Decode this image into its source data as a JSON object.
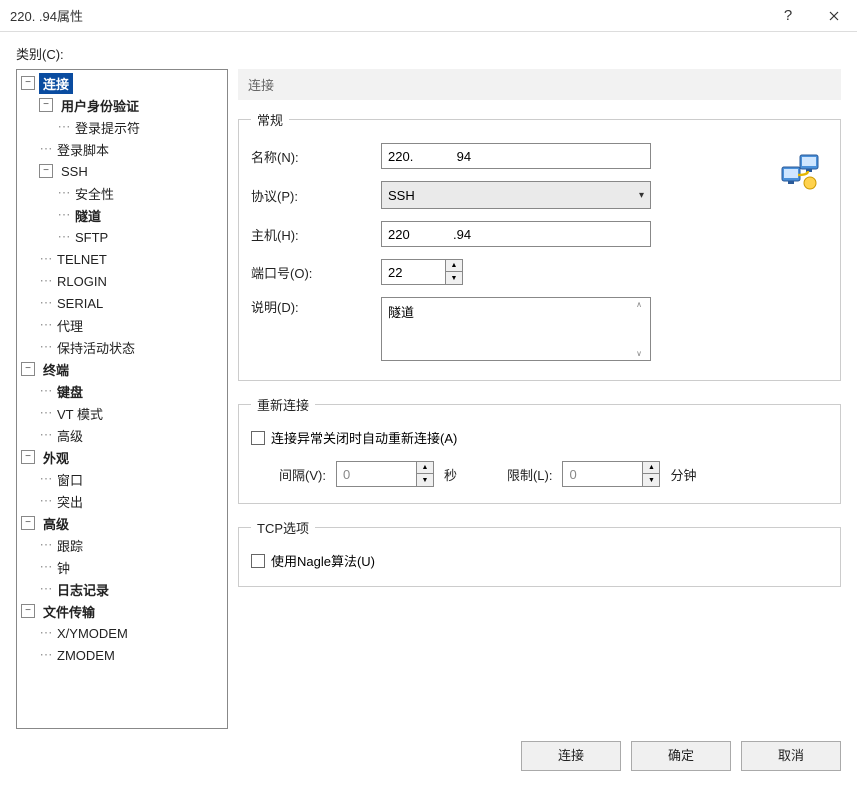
{
  "window": {
    "title": "220.          .94属性",
    "help": "?",
    "close": "×"
  },
  "category_label": "类别(C):",
  "tree": {
    "connection": "连接",
    "user_auth": "用户身份验证",
    "login_prompt": "登录提示符",
    "login_script": "登录脚本",
    "ssh": "SSH",
    "security": "安全性",
    "tunnel": "隧道",
    "sftp": "SFTP",
    "telnet": "TELNET",
    "rlogin": "RLOGIN",
    "serial": "SERIAL",
    "proxy": "代理",
    "keepalive": "保持活动状态",
    "terminal": "终端",
    "keyboard": "键盘",
    "vtmode": "VT 模式",
    "advanced_term": "高级",
    "appearance": "外观",
    "window": "窗口",
    "popup": "突出",
    "advanced": "高级",
    "trace": "跟踪",
    "clock": "钟",
    "logging": "日志记录",
    "filetransfer": "文件传输",
    "xymodem": "X/YMODEM",
    "zmodem": "ZMODEM"
  },
  "section_path": "连接",
  "general": {
    "legend": "常规",
    "name_label": "名称(N):",
    "name_value": "220.            94",
    "protocol_label": "协议(P):",
    "protocol_value": "SSH",
    "host_label": "主机(H):",
    "host_value": "220            .94",
    "port_label": "端口号(O):",
    "port_value": "22",
    "desc_label": "说明(D):",
    "desc_value": "隧道"
  },
  "reconnect": {
    "legend": "重新连接",
    "checkbox_label": "连接异常关闭时自动重新连接(A)",
    "interval_label": "间隔(V):",
    "interval_value": "0",
    "interval_unit": "秒",
    "limit_label": "限制(L):",
    "limit_value": "0",
    "limit_unit": "分钟"
  },
  "tcp": {
    "legend": "TCP选项",
    "nagle_label": "使用Nagle算法(U)"
  },
  "buttons": {
    "connect": "连接",
    "ok": "确定",
    "cancel": "取消"
  }
}
